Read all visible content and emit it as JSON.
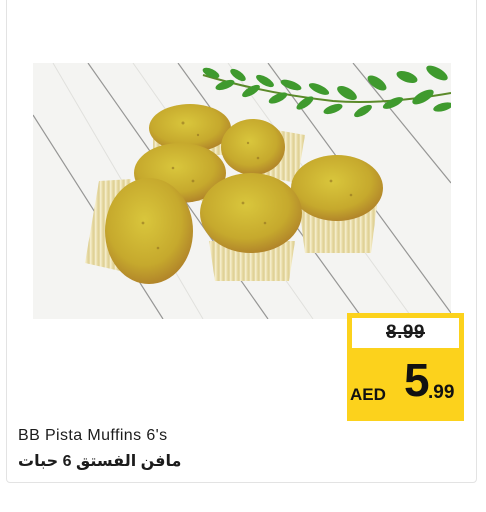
{
  "product": {
    "name_en": "BB Pista Muffins 6's",
    "name_ar": "مافن الفستق 6 حبات",
    "image_subject": "pistachio-muffins-photo"
  },
  "price": {
    "old": "8.99",
    "currency": "AED",
    "new_int": "5",
    "new_dec": ".99"
  },
  "colors": {
    "tag_yellow": "#fcd21c",
    "muffin_top": "#c9b231",
    "muffin_liner": "#efe4b8",
    "background_wood": "#f3f3f1"
  }
}
